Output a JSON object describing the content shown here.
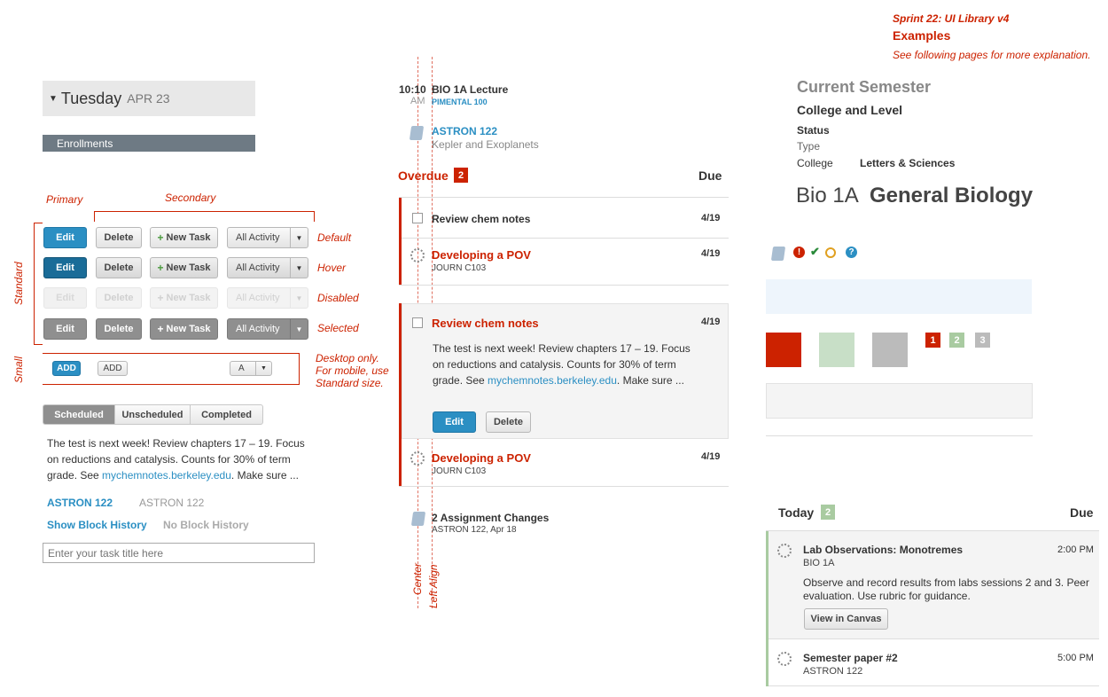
{
  "sprint": {
    "title": "Sprint 22: UI Library v4",
    "examples": "Examples",
    "explanation": "See following pages for more explanation."
  },
  "day": {
    "name": "Tuesday",
    "date": "APR 23"
  },
  "enrollments": "Enrollments",
  "labels": {
    "primary": "Primary",
    "secondary": "Secondary",
    "standard": "Standard",
    "small": "Small",
    "states": [
      "Default",
      "Hover",
      "Disabled",
      "Selected"
    ],
    "desktop_note": [
      "Desktop only.",
      "For mobile, use",
      "Standard size."
    ]
  },
  "buttons": {
    "edit": "Edit",
    "delete": "Delete",
    "new_task": "New Task",
    "all_activity": "All Activity",
    "add": "ADD",
    "a": "A"
  },
  "tabs": [
    "Scheduled",
    "Unscheduled",
    "Completed"
  ],
  "desc_text": "The test is next week! Review chapters 17 – 19. Focus on reductions and catalysis. Counts for 30% of term grade. See ",
  "desc_link": "mychemnotes.berkeley.edu",
  "desc_tail": ". Make sure ...",
  "links": {
    "astron_active": "ASTRON 122",
    "astron_inactive": "ASTRON 122",
    "show_block": "Show Block History",
    "no_block": "No Block History"
  },
  "task_input": {
    "placeholder": "Enter your task title here"
  },
  "schedule": {
    "time": "10:10",
    "ampm": "AM",
    "lecture": "BIO 1A Lecture",
    "location": "PIMENTAL 100",
    "course": "ASTRON 122",
    "course_sub": "Kepler and Exoplanets"
  },
  "overdue": {
    "title": "Overdue",
    "count": "2",
    "due": "Due",
    "items": [
      {
        "title": "Review chem notes",
        "date": "4/19"
      },
      {
        "title": "Developing a POV",
        "sub": "JOURN C103",
        "date": "4/19"
      },
      {
        "title": "Review chem notes",
        "date": "4/19"
      },
      {
        "title": "Developing a POV",
        "sub": "JOURN C103",
        "date": "4/19"
      }
    ]
  },
  "changes": {
    "title": "2 Assignment Changes",
    "sub": "ASTRON 122, Apr 18"
  },
  "guides": {
    "center": "Center",
    "left": "Left Align"
  },
  "semester": {
    "title": "Current Semester",
    "college_level": "College and Level",
    "status": "Status",
    "type": "Type",
    "college_label": "College",
    "college_value": "Letters & Sciences",
    "course_code": "Bio 1A",
    "course_name": "General Biology"
  },
  "badges": [
    "1",
    "2",
    "3"
  ],
  "today": {
    "title": "Today",
    "count": "2",
    "due": "Due",
    "items": [
      {
        "title": "Lab Observations: Monotremes",
        "sub": "BIO 1A",
        "time": "2:00 PM",
        "desc": "Observe and record results from labs sessions 2 and 3. Peer evaluation. Use rubric for guidance.",
        "button": "View in Canvas"
      },
      {
        "title": "Semester paper #2",
        "sub": "ASTRON 122",
        "time": "5:00 PM"
      }
    ]
  },
  "colors": {
    "accent": "#2b8fc3",
    "alert": "#cc2200",
    "green": "#a9cba1",
    "gray": "#bbbbbb"
  }
}
